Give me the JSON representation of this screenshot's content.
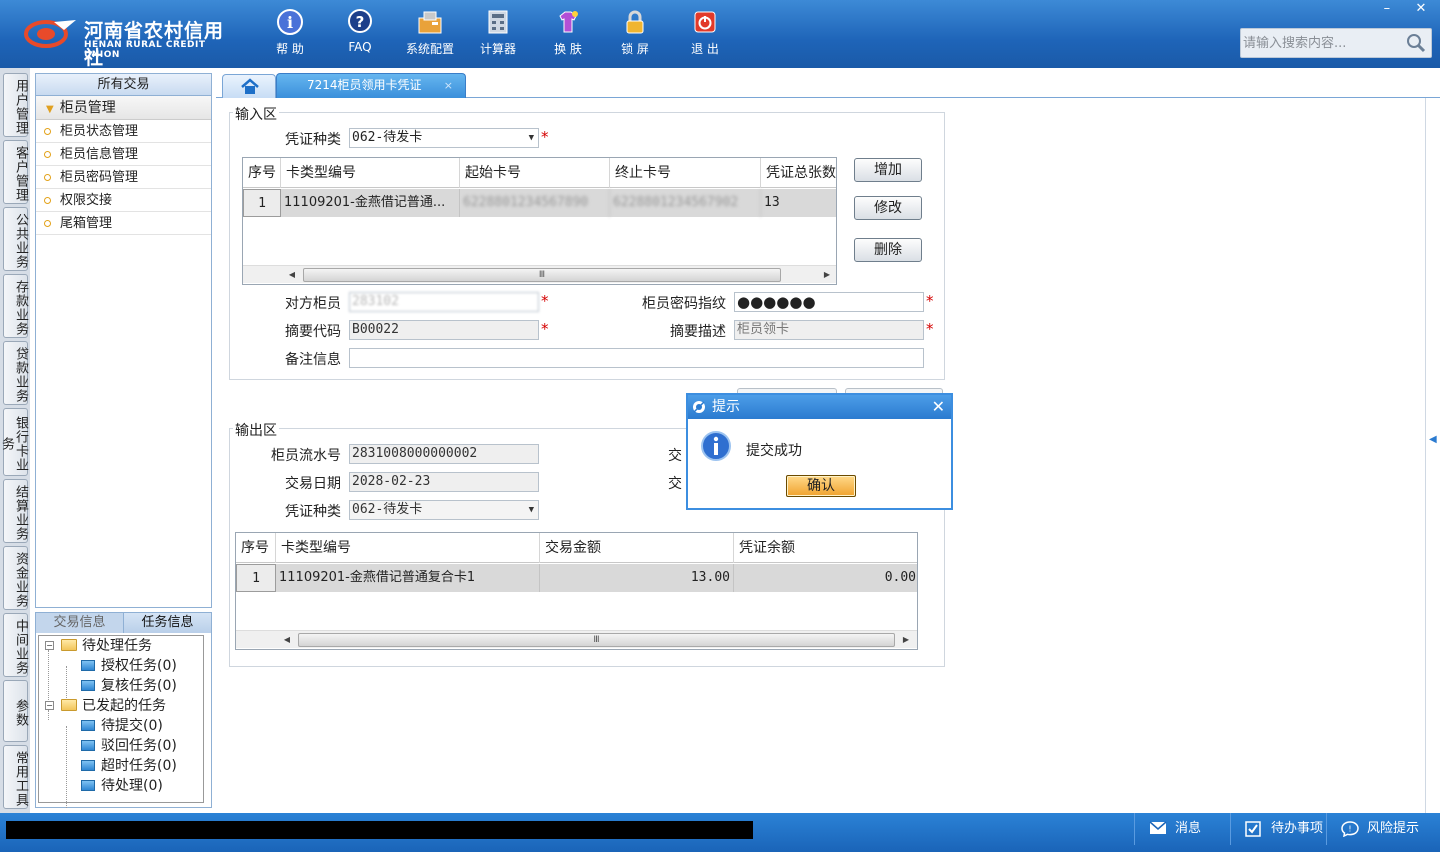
{
  "header": {
    "logo_cn": "河南省农村信用社",
    "logo_en": "HENAN RURAL CREDIT UNION",
    "toolbar": [
      {
        "label": "帮 助",
        "icon": "help-icon"
      },
      {
        "label": "FAQ",
        "icon": "faq-icon"
      },
      {
        "label": "系统配置",
        "icon": "settings-icon"
      },
      {
        "label": "计算器",
        "icon": "calculator-icon"
      },
      {
        "label": "换 肤",
        "icon": "skin-icon"
      },
      {
        "label": "锁 屏",
        "icon": "lock-icon"
      },
      {
        "label": "退 出",
        "icon": "power-icon"
      }
    ],
    "window_controls": {
      "minimize": "–",
      "close": "✕"
    },
    "search": {
      "placeholder": "请输入搜索内容...",
      "value": ""
    }
  },
  "vertical_tabs": [
    "用户管理",
    "客户管理",
    "公共业务",
    "存款业务",
    "贷款业务",
    "银行卡业务",
    "结算业务",
    "资金业务",
    "中间业务",
    "参数",
    "常用工具"
  ],
  "menu": {
    "header": "所有交易",
    "group": "柜员管理",
    "items": [
      "柜员状态管理",
      "柜员信息管理",
      "柜员密码管理",
      "权限交接",
      "尾箱管理"
    ]
  },
  "task_panel": {
    "tabs": [
      "交易信息",
      "任务信息"
    ],
    "active_tab": "任务信息",
    "tree": {
      "pending": {
        "label": "待处理任务",
        "children": [
          "授权任务(0)",
          "复核任务(0)"
        ]
      },
      "initiated": {
        "label": "已发起的任务",
        "children": [
          "待提交(0)",
          "驳回任务(0)",
          "超时任务(0)",
          "待处理(0)"
        ]
      }
    }
  },
  "content_tabs": {
    "active": "7214柜员领用卡凭证",
    "close": "×"
  },
  "input_area": {
    "title": "输入区",
    "voucher_type_label": "凭证种类",
    "voucher_type_value": "062-待发卡",
    "grid": {
      "columns": [
        "序号",
        "卡类型编号",
        "起始卡号",
        "终止卡号",
        "凭证总张数"
      ],
      "rows": [
        {
          "no": "1",
          "card_type": "11109201-金燕借记普通...",
          "start": "6228801234567890",
          "end": "6228801234567902",
          "count": "13"
        }
      ],
      "scroll_thumb": "Ⅲ"
    },
    "buttons": {
      "add": "增加",
      "edit": "修改",
      "delete": "删除"
    },
    "counterpart_label": "对方柜员",
    "counterpart_value": "283102",
    "password_label": "柜员密码指纹",
    "password_value": "●●●●●●",
    "summary_code_label": "摘要代码",
    "summary_code_value": "B00022",
    "summary_desc_label": "摘要描述",
    "summary_desc_value": "柜员领卡",
    "remark_label": "备注信息",
    "remark_value": "",
    "required_mark": "*"
  },
  "output_area": {
    "title": "输出区",
    "serial_label": "柜员流水号",
    "serial_value": "2831008000000002",
    "date_label": "交易日期",
    "date_value": "2028-02-23",
    "voucher_type_label": "凭证种类",
    "voucher_type_value": "062-待发卡",
    "right_label_1": "交",
    "right_label_2": "交",
    "grid": {
      "columns": [
        "序号",
        "卡类型编号",
        "交易金额",
        "凭证余额"
      ],
      "rows": [
        {
          "no": "1",
          "card_type": "11109201-金燕借记普通复合卡1",
          "amount": "13.00",
          "balance": "0.00"
        }
      ],
      "scroll_thumb": "Ⅲ"
    }
  },
  "dialog": {
    "title": "提示",
    "message": "提交成功",
    "ok": "确认",
    "close": "✕"
  },
  "statusbar": {
    "messages": "消息",
    "todo": "待办事项",
    "risk": "风险提示"
  },
  "colors": {
    "header_blue": "#1e64b8",
    "tab_active": "#3a8fdb",
    "required": "#d40000",
    "dialog_ok": "#f0a22e"
  }
}
